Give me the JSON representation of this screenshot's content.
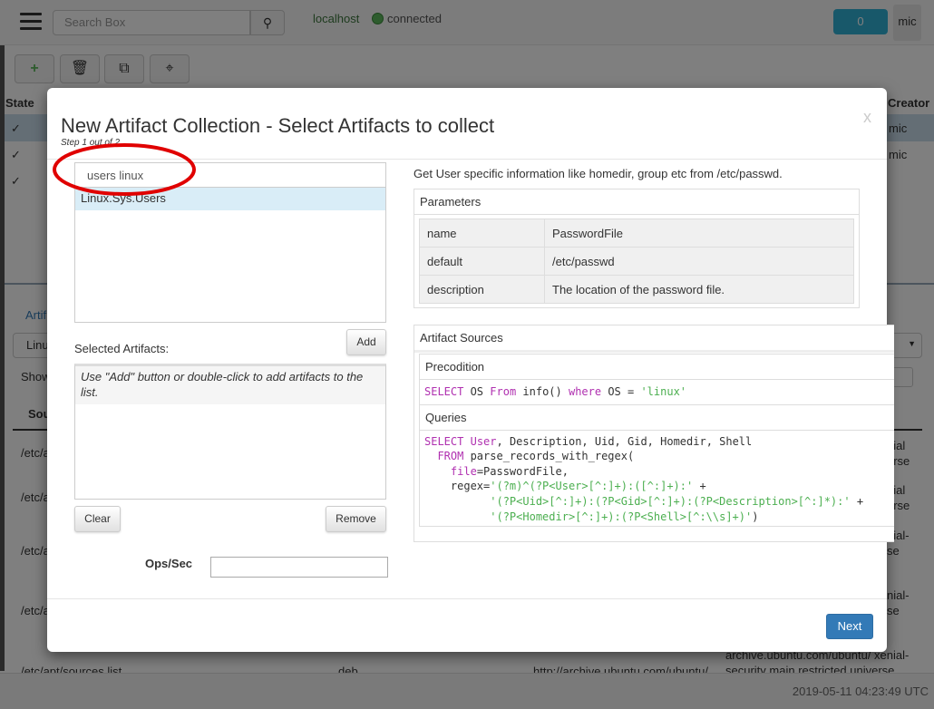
{
  "navbar": {
    "search_placeholder": "Search Box",
    "host": "localhost",
    "status": "connected",
    "notification_count": "0",
    "user": "mic"
  },
  "toolbar": {
    "icons": [
      "plus-icon",
      "trash-icon",
      "copy-icon",
      "crosshair-icon"
    ]
  },
  "background_table": {
    "headers": [
      "State",
      "Creator"
    ],
    "rows": [
      {
        "creator": "mic"
      },
      {
        "creator": "mic"
      },
      {
        "creator": ""
      }
    ]
  },
  "background_lower": {
    "tab": "Artif",
    "select_value": "Linu",
    "show": "Show",
    "column": "Sou",
    "rows": [
      "/etc/a",
      "/etc/a",
      "/etc/a",
      "/etc/a"
    ],
    "right_rows": [
      "nial\nerse",
      "nial\nerse",
      "nial-\nse",
      "nial-\nse"
    ],
    "last_row": {
      "file": "/etc/apt/sources.list",
      "type": "deb",
      "uri": "http://archive.ubuntu.com/ubuntu/",
      "dist": "archive.ubuntu.com/ubuntu/ xenial-security main restricted universe"
    },
    "timestamp": "2019-05-11 04:23:49 UTC"
  },
  "modal": {
    "title": "New Artifact Collection - Select Artifacts to collect",
    "step": "Step 1 out of 2",
    "close": "x",
    "search_value": "users linux",
    "results": [
      "Linux.Sys.Users"
    ],
    "add_label": "Add",
    "selected_label": "Selected Artifacts:",
    "selected_hint": "Use \"Add\" button or double-click to add artifacts to the list.",
    "clear_label": "Clear",
    "remove_label": "Remove",
    "ops_label": "Ops/Sec",
    "ops_value": "",
    "description": "Get User specific information like homedir, group etc from /etc/passwd.",
    "parameters_heading": "Parameters",
    "parameters": [
      [
        "name",
        "PasswordFile"
      ],
      [
        "default",
        "/etc/passwd"
      ],
      [
        "description",
        "The location of the password file."
      ]
    ],
    "sources_heading": "Artifact Sources",
    "precondition_heading": "Precodition",
    "precondition": "SELECT OS From info() where OS = 'linux'",
    "queries_heading": "Queries",
    "query": "SELECT User, Description, Uid, Gid, Homedir, Shell\n  FROM parse_records_with_regex(\n    file=PasswordFile,\n    regex='(?m)^(?P<User>[^:]+):([^:]+):' +\n          '(?P<Uid>[^:]+):(?P<Gid>[^:]+):(?P<Description>[^:]*):' +\n          '(?P<Homedir>[^:]+):(?P<Shell>[^:\\\\s]+)')",
    "next_label": "Next"
  },
  "colors": {
    "primary": "#337ab7",
    "info": "#31b0d5",
    "selected": "#d9edf7",
    "annotation": "#e00000"
  }
}
